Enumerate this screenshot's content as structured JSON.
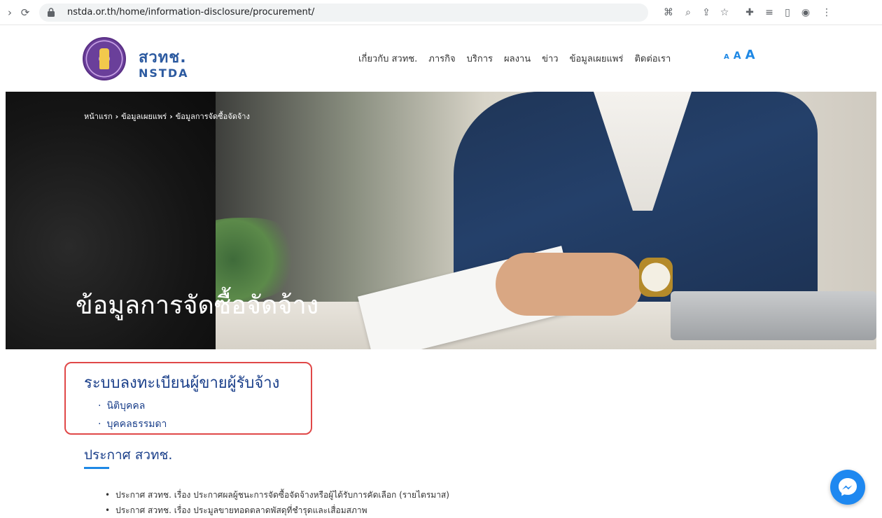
{
  "browser": {
    "url": "nstda.or.th/home/information-disclosure/procurement/"
  },
  "header": {
    "logo_th": "สวทช.",
    "logo_en": "NSTDA",
    "nav": [
      "เกี่ยวกับ สวทช.",
      "ภารกิจ",
      "บริการ",
      "ผลงาน",
      "ข่าว",
      "ข้อมูลเผยแพร่",
      "ติดต่อเรา"
    ],
    "font_sizes": [
      "A",
      "A",
      "A"
    ]
  },
  "hero": {
    "breadcrumb": [
      "หน้าแรก",
      "ข้อมูลเผยแพร่",
      "ข้อมูลการจัดซื้อจัดจ้าง"
    ],
    "breadcrumb_sep": "›",
    "title": "ข้อมูลการจัดซื้อจัดจ้าง"
  },
  "registration": {
    "title": "ระบบลงทะเบียนผู้ขายผู้รับจ้าง",
    "items": [
      "นิติบุคคล",
      "บุคคลธรรมดา"
    ]
  },
  "announcements": {
    "title": "ประกาศ สวทช.",
    "items": [
      "ประกาศ สวทช. เรื่อง ประกาศผลผู้ชนะการจัดซื้อจัดจ้างหรือผู้ได้รับการคัดเลือก (รายไตรมาส)",
      "ประกาศ สวทช. เรื่อง ประมูลขายทอดตลาดพัสดุที่ชำรุดและเสื่อมสภาพ"
    ]
  },
  "colors": {
    "brand_blue": "#1a3f8a",
    "accent_blue": "#1e88e5",
    "highlight_red": "#e04848"
  }
}
